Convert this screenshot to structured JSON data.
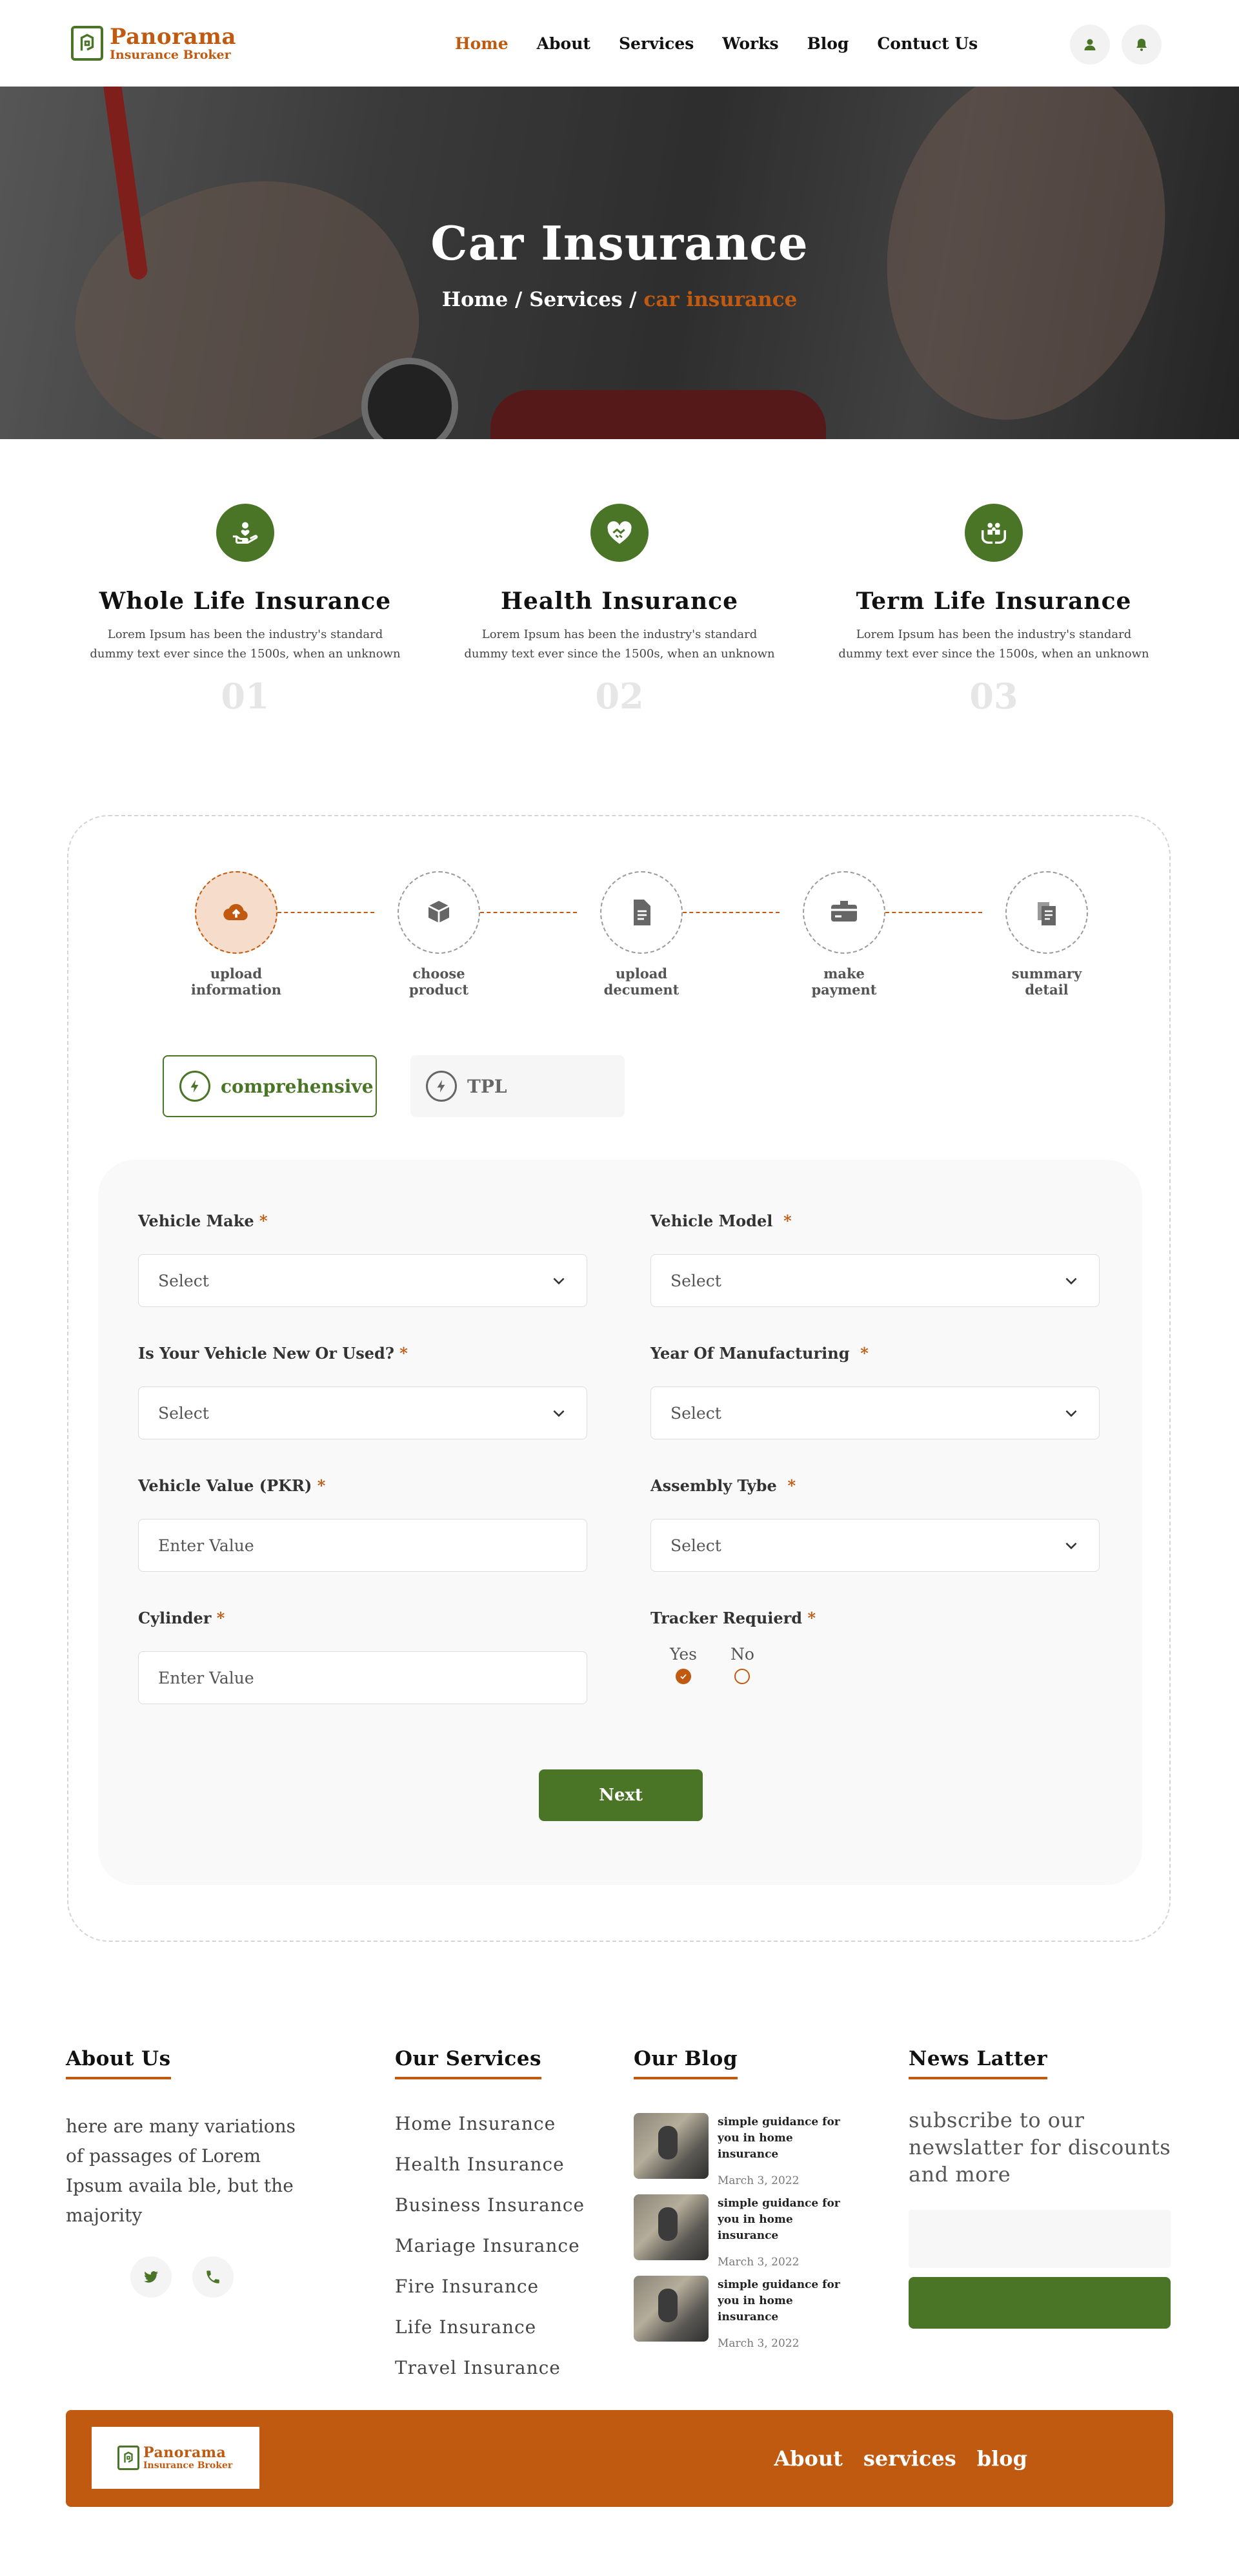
{
  "brand": {
    "name": "Panorama",
    "tagline": "Insurance Broker"
  },
  "nav": [
    {
      "label": "Home",
      "active": true
    },
    {
      "label": "About",
      "active": false
    },
    {
      "label": "Services",
      "active": false
    },
    {
      "label": "Works",
      "active": false
    },
    {
      "label": "Blog",
      "active": false
    },
    {
      "label": "Contuct Us",
      "active": false
    }
  ],
  "header_icons": [
    "user-icon",
    "bell-icon"
  ],
  "hero": {
    "title": "Car Insurance",
    "breadcrumb": {
      "home": "Home",
      "sep1": " / ",
      "services": "Services",
      "sep2": " / ",
      "current": "car insurance"
    }
  },
  "features": [
    {
      "icon": "hand-heart-icon",
      "title": "Whole Life Insurance",
      "desc_line1": "Lorem Ipsum has been the industry's standard",
      "desc_line2": "dummy text ever since the 1500s, when an unknown",
      "number": "01"
    },
    {
      "icon": "handshake-heart-icon",
      "title": "Health Insurance",
      "desc_line1": "Lorem Ipsum has been the industry's standard",
      "desc_line2": "dummy text ever since the 1500s, when an unknown",
      "number": "02"
    },
    {
      "icon": "family-care-icon",
      "title": "Term Life Insurance",
      "desc_line1": "Lorem Ipsum has been the industry's standard",
      "desc_line2": "dummy text ever since the 1500s, when an unknown",
      "number": "03"
    }
  ],
  "steps": [
    {
      "line1": "upload",
      "line2": "information",
      "icon": "cloud-upload-icon",
      "active": true
    },
    {
      "line1": "choose",
      "line2": "product",
      "icon": "box-icon",
      "active": false
    },
    {
      "line1": "upload",
      "line2": "decument",
      "icon": "document-icon",
      "active": false
    },
    {
      "line1": "make",
      "line2": "payment",
      "icon": "card-icon",
      "active": false
    },
    {
      "line1": "summary",
      "line2": "detail",
      "icon": "files-icon",
      "active": false
    }
  ],
  "tabs": [
    {
      "label": "comprehensive",
      "active": true
    },
    {
      "label": "TPL",
      "active": false
    }
  ],
  "form": {
    "required_mark": "*",
    "vehicle_make": {
      "label": "Vehicle Make",
      "value": "Select"
    },
    "vehicle_model": {
      "label": "Vehicle Model",
      "value": "Select"
    },
    "new_or_used": {
      "label": "Is Your Vehicle New Or Used?",
      "value": "Select"
    },
    "year": {
      "label": "Year Of Manufacturing",
      "value": "Select"
    },
    "vehicle_value": {
      "label": "Vehicle Value (PKR)",
      "placeholder": "Enter Value"
    },
    "assembly": {
      "label": "Assembly Tybe",
      "value": "Select"
    },
    "cylinder": {
      "label": "Cylinder",
      "placeholder": "Enter Value"
    },
    "tracker": {
      "label": "Tracker Requierd",
      "options": [
        {
          "label": "Yes",
          "checked": true
        },
        {
          "label": "No",
          "checked": false
        }
      ]
    },
    "next_label": "Next"
  },
  "footer": {
    "about": {
      "heading": "About Us",
      "text": "here are many variations of passages of Lorem Ipsum availa ble, but the majority",
      "social": [
        "twitter-icon",
        "phone-icon"
      ]
    },
    "services": {
      "heading": "Our Services",
      "items": [
        "Home Insurance",
        "Health Insurance",
        "Business Insurance",
        "Mariage Insurance",
        "Fire Insurance",
        "Life Insurance",
        "Travel Insurance"
      ]
    },
    "blog": {
      "heading": "Our Blog",
      "posts": [
        {
          "title": "simple guidance for you in home insurance",
          "date": "March 3, 2022"
        },
        {
          "title": "simple guidance for you in home insurance",
          "date": "March 3, 2022"
        },
        {
          "title": "simple guidance for you in home insurance",
          "date": "March 3, 2022"
        }
      ]
    },
    "newsletter": {
      "heading": "News Latter",
      "text": "subscribe to our newslatter for discounts and more"
    }
  },
  "bottom_links": [
    "About",
    "services",
    "blog"
  ],
  "colors": {
    "brand_green": "#4a7527",
    "brand_orange": "#c05a10"
  }
}
